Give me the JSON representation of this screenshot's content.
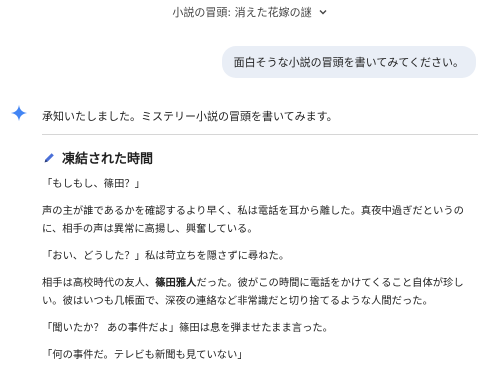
{
  "topbar": {
    "title": "小説の冒頭: 消えた花嫁の謎",
    "chevron_icon": "chevron-down-icon"
  },
  "user_message": "面白そうな小説の冒頭を書いてみてください。",
  "assistant": {
    "icon": "gemini-spark-icon",
    "ack": "承知いたしました。ミステリー小説の冒頭を書いてみます。",
    "heading_icon": "pen-icon",
    "heading": "凍結された時間",
    "p1": "「もしもし、篠田？」",
    "p2": "声の主が誰であるかを確認するより早く、私は電話を耳から離した。真夜中過ぎだというのに、相手の声は異常に高揚し、興奮している。",
    "p3": "「おい、どうした？」私は苛立ちを隠さずに尋ねた。",
    "p4_pre": "相手は高校時代の友人、",
    "p4_bold": "篠田雅人",
    "p4_post": "だった。彼がこの時間に電話をかけてくること自体が珍しい。彼はいつも几帳面で、深夜の連絡など非常識だと切り捨てるような人間だった。",
    "p5": "「聞いたか？ あの事件だよ」篠田は息を弾ませたまま言った。",
    "p6": "「何の事件だ。テレビも新聞も見ていない」"
  },
  "colors": {
    "spark": "#4285f4",
    "pen": "#4a6fd8",
    "bubble": "#e9eef6"
  }
}
